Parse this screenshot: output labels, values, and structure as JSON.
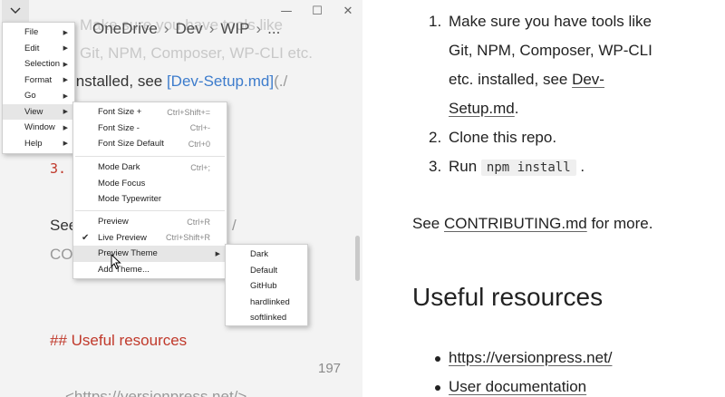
{
  "window": {
    "minimize": "—",
    "maximize": "☐",
    "close": "✕"
  },
  "breadcrumb": [
    "OneDrive",
    "Dev",
    "WIP",
    "..."
  ],
  "editor": {
    "ghost_line_1": "Make sure you have tools like",
    "ghost_line_2": "Git, NPM, Composer, WP-CLI etc.",
    "line_installed_a": "installed, see ",
    "line_installed_link": "[Dev-Setup.md]",
    "line_installed_b": "(./",
    "line_3_num": "3.",
    "line_see_a": "See",
    "line_see_b": "/",
    "line_co": "CO",
    "heading_md": "## Useful resources",
    "line_number": "197",
    "bottom_link": "<https://versionpress.net/>"
  },
  "main_menu": [
    {
      "label": "File",
      "arrow": "▶"
    },
    {
      "label": "Edit",
      "arrow": "▶"
    },
    {
      "label": "Selection",
      "arrow": "▶"
    },
    {
      "label": "Format",
      "arrow": "▶"
    },
    {
      "label": "Go",
      "arrow": "▶"
    },
    {
      "label": "View",
      "arrow": "▶"
    },
    {
      "label": "Window",
      "arrow": "▶"
    },
    {
      "label": "Help",
      "arrow": "▶"
    }
  ],
  "view_menu": [
    {
      "label": "Font Size +",
      "accel": "Ctrl+Shift+="
    },
    {
      "label": "Font Size -",
      "accel": "Ctrl+-"
    },
    {
      "label": "Font Size Default",
      "accel": "Ctrl+0"
    },
    {
      "label": "Mode Dark",
      "accel": "Ctrl+;"
    },
    {
      "label": "Mode Focus",
      "accel": ""
    },
    {
      "label": "Mode Typewriter",
      "accel": ""
    },
    {
      "label": "Preview",
      "accel": "Ctrl+R"
    },
    {
      "label": "Live Preview",
      "accel": "Ctrl+Shift+R",
      "check": "✔"
    },
    {
      "label": "Preview Theme",
      "accel": "",
      "arrow": "▶"
    },
    {
      "label": "Add Theme...",
      "accel": ""
    }
  ],
  "theme_menu": [
    "Dark",
    "Default",
    "GitHub",
    "hardlinked",
    "softlinked"
  ],
  "preview": {
    "item1_num": "1.",
    "item1_l1": "Make sure you have tools like",
    "item1_l2": "Git, NPM, Composer, WP-CLI",
    "item1_l3a": "etc. installed, see ",
    "item1_l3link": "Dev-",
    "item1_l4link": "Setup.md",
    "item1_l4b": ".",
    "item2_num": "2.",
    "item2": "Clone this repo.",
    "item3_num": "3.",
    "item3_a": "Run ",
    "item3_code": "npm install",
    "item3_b": " .",
    "see_a": "See ",
    "see_link": "CONTRIBUTING.md",
    "see_b": " for more.",
    "heading": "Useful resources",
    "link1": "https://versionpress.net/",
    "link2": "User documentation"
  }
}
